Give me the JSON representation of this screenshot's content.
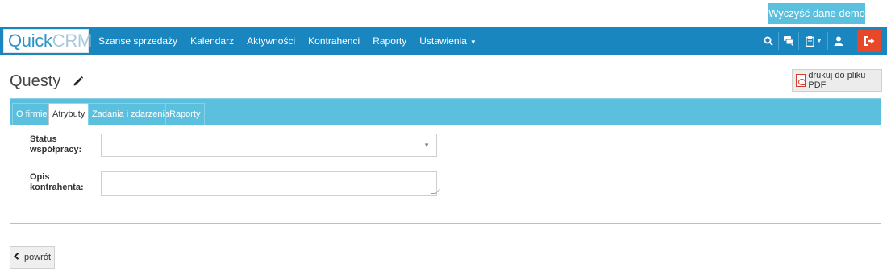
{
  "top_bar": {
    "demo_button_label": "Wyczyść dane demo"
  },
  "navbar": {
    "logo_part1": "Quick",
    "logo_part2": "CRM",
    "items": [
      {
        "label": "Szanse sprzedaży"
      },
      {
        "label": "Kalendarz"
      },
      {
        "label": "Aktywności"
      },
      {
        "label": "Kontrahenci"
      },
      {
        "label": "Raporty"
      },
      {
        "label": "Ustawienia"
      }
    ],
    "icons": [
      "search-icon",
      "comments-icon",
      "clipboard-icon",
      "user-icon",
      "logout-icon"
    ],
    "logout_color": "#e8482a",
    "bar_color": "#1a86c0"
  },
  "page": {
    "title": "Questy",
    "pdf_button_label": "drukuj do pliku PDF",
    "back_button_label": "powrót"
  },
  "tabs": [
    {
      "label": "O firmie",
      "active": false
    },
    {
      "label": "Atrybuty",
      "active": true
    },
    {
      "label": "Zadania i zdarzenia",
      "active": false
    },
    {
      "label": "Raporty",
      "active": false
    }
  ],
  "form": {
    "status_label_line1": "Status",
    "status_label_line2": "współpracy:",
    "status_value": "",
    "opis_label_line1": "Opis",
    "opis_label_line2": "kontrahenta:",
    "opis_value": ""
  }
}
